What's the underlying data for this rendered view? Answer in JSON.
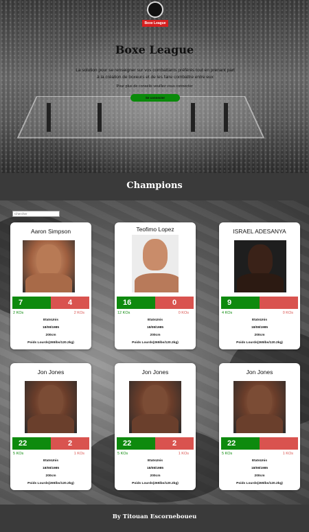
{
  "header": {
    "logo_text": "Boxe League",
    "title": "Boxe League",
    "description": "La solution pour se renseigner sur vos combattants préférés tout en prenant part à la création de boxeurs et de les faire combattre entre eux",
    "login_prompt": "Pour plus de conseils veuillez vous connecter",
    "login_button": "Se connecter"
  },
  "section": {
    "title": "Champions"
  },
  "search": {
    "placeholder": "Chercher"
  },
  "fighters": [
    {
      "name": "Aaron Simpson",
      "wins": "7",
      "losses": "4",
      "kos_wins": "2 KOs",
      "kos_losses": "2 KOs",
      "country": "EtatsUnis",
      "dob": "18/08/1985",
      "height": "200cm",
      "weight_class": "Poids Lourds(265lbs/120.2kg)"
    },
    {
      "name": "Teofimo Lopez",
      "wins": "16",
      "losses": "0",
      "kos_wins": "12 KOs",
      "kos_losses": "0 KOs",
      "country": "EtatsUnis",
      "dob": "18/08/1985",
      "height": "200cm",
      "weight_class": "Poids Lourds(265lbs/120.2kg)"
    },
    {
      "name": "ISRAEL ADESANYA",
      "wins": "9",
      "losses": "",
      "kos_wins": "4 KOs",
      "kos_losses": "0 KOs",
      "country": "EtatsUnis",
      "dob": "18/08/1985",
      "height": "200cm",
      "weight_class": "Poids Lourds(265lbs/120.2kg)"
    },
    {
      "name": "Jon Jones",
      "wins": "22",
      "losses": "2",
      "kos_wins": "5 KOs",
      "kos_losses": "1 KOs",
      "country": "EtatsUnis",
      "dob": "18/08/1985",
      "height": "200cm",
      "weight_class": "Poids Lourds(265lbs/120.2kg)"
    },
    {
      "name": "Jon Jones",
      "wins": "22",
      "losses": "2",
      "kos_wins": "5 KOs",
      "kos_losses": "1 KOs",
      "country": "EtatsUnis",
      "dob": "18/08/1985",
      "height": "200cm",
      "weight_class": "Poids Lourds(265lbs/120.2kg)"
    },
    {
      "name": "Jon Jones",
      "wins": "22",
      "losses": "",
      "kos_wins": "5 KOs",
      "kos_losses": "1 KOs",
      "country": "EtatsUnis",
      "dob": "18/08/1985",
      "height": "200cm",
      "weight_class": "Poids Lourds(265lbs/120.2kg)"
    }
  ],
  "footer": {
    "text": "By Titouan Escorneboueu"
  },
  "colors": {
    "win": "#0e8a0e",
    "loss": "#d9534f",
    "band": "#3a3a3a",
    "button": "#0a8a0a",
    "logo_badge": "#d62020"
  }
}
